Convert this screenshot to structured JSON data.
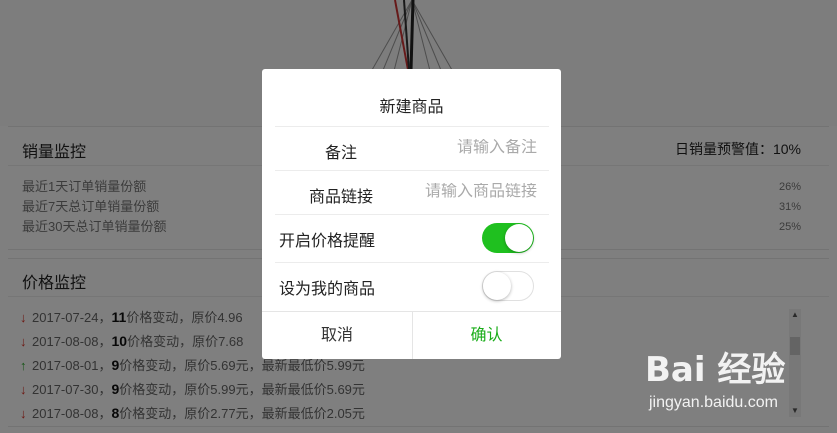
{
  "sales_monitor": {
    "title": "销量监控",
    "threshold": "日销量预警值：10%",
    "rows": [
      {
        "label": "最近1天订单销量份额",
        "value": "26%"
      },
      {
        "label": "最近7天总订单销量份额",
        "value": "31%"
      },
      {
        "label": "最近30天总订单销量份额",
        "value": "25%"
      }
    ]
  },
  "price_monitor": {
    "title": "价格监控",
    "log": [
      {
        "direction": "down",
        "date": "2017-07-24，",
        "count": "11",
        "text": "价格变动，原价4.96"
      },
      {
        "direction": "down",
        "date": "2017-08-08，",
        "count": "10",
        "text": "价格变动，原价7.68"
      },
      {
        "direction": "up",
        "date": "2017-08-01，",
        "count": "9",
        "text": "价格变动，原价5.69元，最新最低价5.99元"
      },
      {
        "direction": "down",
        "date": "2017-07-30，",
        "count": "9",
        "text": "价格变动，原价5.99元，最新最低价5.69元"
      },
      {
        "direction": "down",
        "date": "2017-08-08，",
        "count": "8",
        "text": "价格变动，原价2.77元，最新最低价2.05元"
      }
    ]
  },
  "modal": {
    "title": "新建商品",
    "note_label": "备注",
    "note_placeholder": "请输入备注",
    "link_label": "商品链接",
    "link_placeholder": "请输入商品链接",
    "price_alert_label": "开启价格提醒",
    "price_alert_on": true,
    "my_product_label": "设为我的商品",
    "my_product_on": false,
    "cancel_label": "取消",
    "confirm_label": "确认",
    "accent_color": "#1aad19"
  },
  "watermark": {
    "logo": "Bai 经验",
    "url": "jingyan.baidu.com"
  }
}
